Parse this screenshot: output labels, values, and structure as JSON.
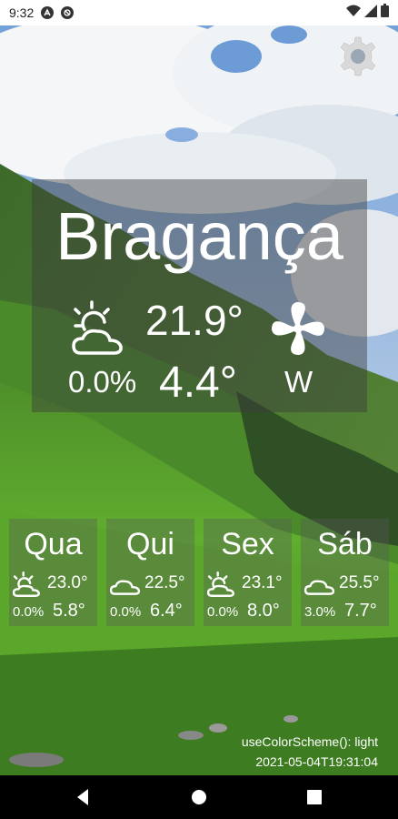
{
  "status_bar": {
    "time": "9:32",
    "icons": [
      "a-circle-icon",
      "blocked-circle-icon",
      "wifi-icon",
      "signal-icon",
      "battery-icon"
    ]
  },
  "settings": {
    "icon": "gear-icon"
  },
  "current": {
    "city": "Bragança",
    "icon": "partly-cloudy-sun-icon",
    "temperature": "21.9°",
    "precipitation": "0.0%",
    "wind_icon": "fan-wind-icon",
    "wind_speed": "4.4°",
    "wind_direction": "W"
  },
  "forecast": [
    {
      "day": "Qua",
      "icon": "partly-cloudy-sun-icon",
      "max": "23.0°",
      "precip": "0.0%",
      "min": "5.8°"
    },
    {
      "day": "Qui",
      "icon": "cloud-icon",
      "max": "22.5°",
      "precip": "0.0%",
      "min": "6.4°"
    },
    {
      "day": "Sex",
      "icon": "partly-cloudy-sun-icon",
      "max": "23.1°",
      "precip": "0.0%",
      "min": "8.0°"
    },
    {
      "day": "Sáb",
      "icon": "cloud-icon",
      "max": "25.5°",
      "precip": "3.0%",
      "min": "7.7°"
    }
  ],
  "footer": {
    "color_scheme": "useColorScheme(): light",
    "timestamp": "2021-05-04T19:31:04"
  },
  "nav": {
    "back": "back-triangle-icon",
    "home": "home-circle-icon",
    "recents": "recents-square-icon"
  },
  "colors": {
    "text": "#ffffff",
    "panel": "#3c3c3c",
    "status_bar": "#ffffff",
    "nav_bar": "#000000"
  }
}
